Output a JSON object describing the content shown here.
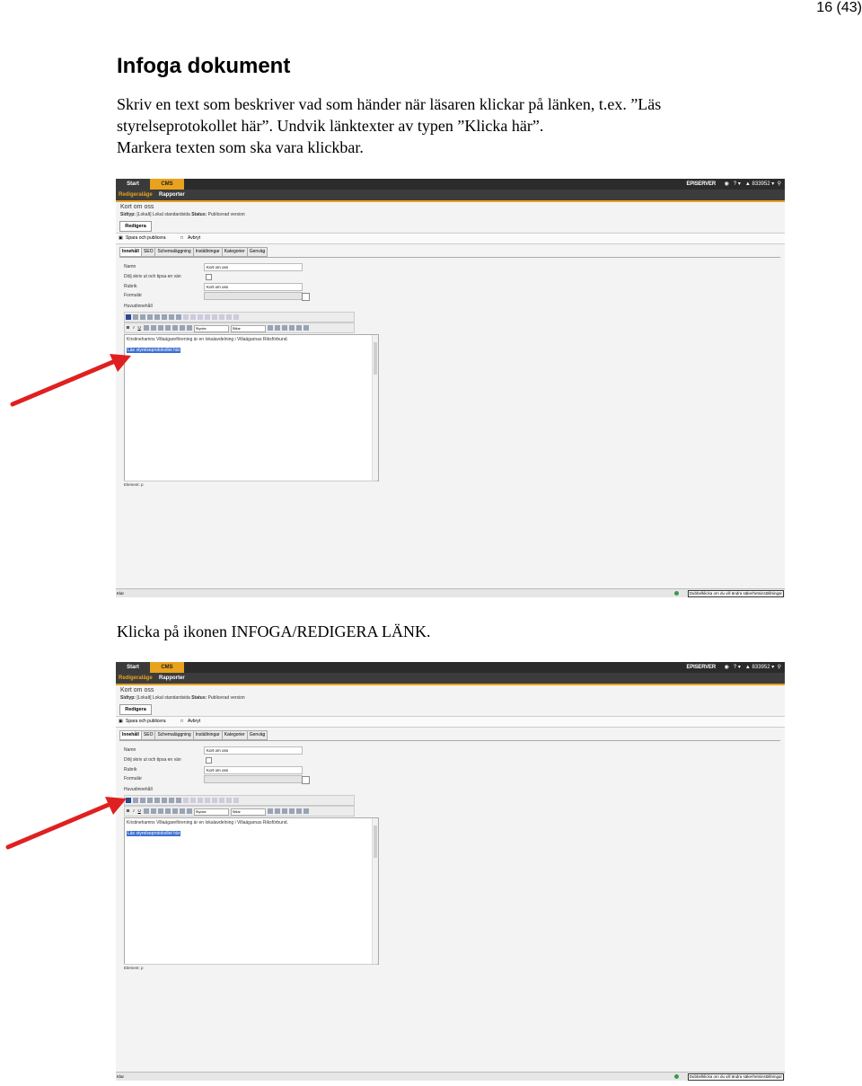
{
  "page_number": "16 (43)",
  "title": "Infoga dokument",
  "intro_lines": [
    "Skriv en text som beskriver vad som händer när läsaren klickar på länken, t.ex. ”Läs",
    "styrelseprotokollet här”. Undvik länktexter av typen ”Klicka här”.",
    "Markera texten som ska vara klickbar."
  ],
  "instruction2": {
    "prefix": "Klicka på ikonen ",
    "term": "INFOGA/REDIGERA LÄNK",
    "suffix": "."
  },
  "screenshot": {
    "tab_start": "Start",
    "tab_cms": "CMS",
    "brand": "EPISERVER",
    "help": "? ▾",
    "user": "833952 ▾",
    "sub_edit": "Redigeraläge",
    "sub_reports": "Rapporter",
    "page_title": "Kort om oss",
    "page_type_label": "Sidtyp:",
    "page_type_value": "[Lokalt] Lokal standardsida",
    "status_label": "Status:",
    "status_value": "Publicerad version",
    "edit_button": "Redigera",
    "save_publish": "Spara och publicera",
    "cancel": "Avbryt",
    "tabs": [
      "Innehåll",
      "SEO",
      "Schemaläggning",
      "Inställningar",
      "Kategorier",
      "Genväg"
    ],
    "field_name_label": "Namn",
    "field_name_value": "Kort om oss",
    "field_hide_label": "Dölj skriv ut och tipsa en vän",
    "field_heading_label": "Rubrik",
    "field_heading_value": "Kort om oss",
    "field_form_label": "Formulär",
    "main_content_label": "Huvudinnehåll",
    "style_select": "Stycke",
    "styles_select": "Stilar",
    "editor_line1": "Kristinehamns Villaägareförening är en lokalavdelning i Villaägarnas Riksförbund.",
    "editor_line2": "Läs styrelseprotokollet här",
    "element_path": "Element: p",
    "status_left": "Klar",
    "status_right": "Dubbelklicka om du vill ändra säkerhetsinställningar"
  },
  "colors": {
    "arrow": "#e02020",
    "cms_tab": "#e8a21d",
    "selection": "#3b6fd1"
  }
}
